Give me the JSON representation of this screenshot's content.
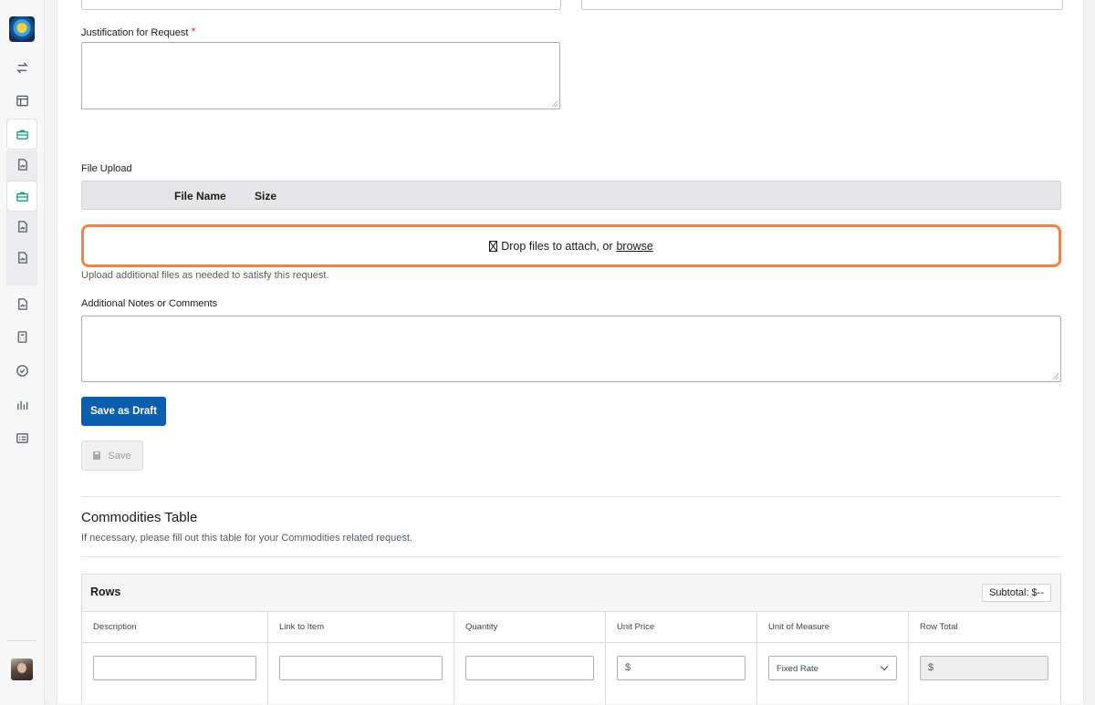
{
  "form": {
    "justification_label": "Justification for Request",
    "required_mark": "*",
    "file_upload_label": "File Upload",
    "file_table_headers": [
      "File Name",
      "Size"
    ],
    "dropzone_text": "Drop files to attach, or",
    "dropzone_link": "browse",
    "upload_hint": "Upload additional files as needed to satisfy this request.",
    "notes_label": "Additional Notes or Comments",
    "save_draft_label": "Save as Draft",
    "save_label": "Save"
  },
  "commodities": {
    "title": "Commodities Table",
    "description": "If necessary, please fill out this table for your Commodities related request.",
    "rows_label": "Rows",
    "subtotal_label": "Subtotal: $--",
    "columns": [
      "Description",
      "Link to Item",
      "Quantity",
      "Unit Price",
      "Unit of Measure",
      "Row Total"
    ],
    "unit_price_prefix": "$",
    "unit_of_measure_value": "Fixed Rate",
    "row_total_prefix": "$"
  },
  "colors": {
    "primary": "#0a5ead",
    "dropzone_border": "#ef8350",
    "required": "#d83933",
    "accent_teal": "#1a9c7e"
  },
  "sidebar_icons": [
    "logo",
    "swap-arrows-icon",
    "layout-icon",
    "briefcase-icon",
    "document-icon",
    "briefcase-icon",
    "document-icon",
    "document-icon",
    "document-icon",
    "calculator-icon",
    "check-circle-icon",
    "bar-chart-icon",
    "list-card-icon",
    "user-avatar"
  ]
}
